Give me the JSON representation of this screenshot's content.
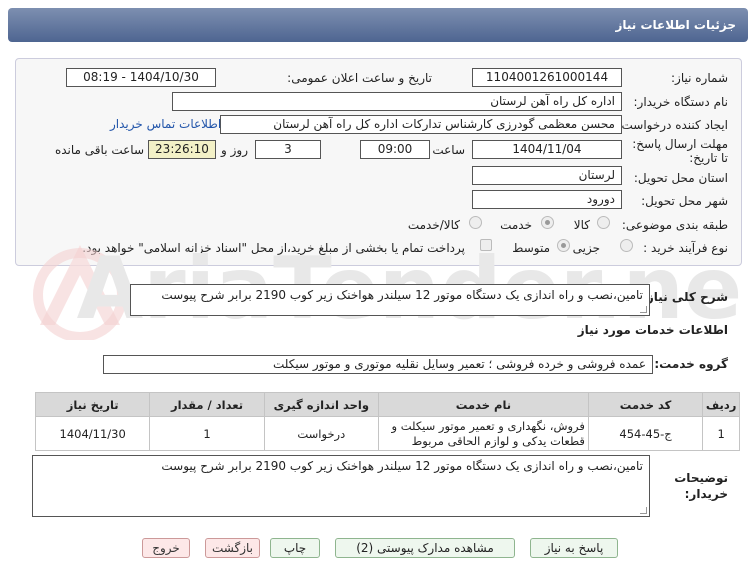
{
  "header": {
    "title": "جزئیات اطلاعات نیاز"
  },
  "form": {
    "need_number_label": "شماره نیاز:",
    "need_number": "1104001261000144",
    "announce_label": "تاریخ و ساعت اعلان عمومی:",
    "announce_value": "1404/10/30 - 08:19",
    "buyer_org_label": "نام دستگاه خریدار:",
    "buyer_org": "اداره کل راه آهن لرستان",
    "creator_label": "ایجاد کننده درخواست:",
    "creator": "محسن معظمی گودرزی کارشناس تدارکات اداره کل راه آهن لرستان",
    "contact_link": "اطلاعات تماس خریدار",
    "deadline_label": "مهلت ارسال پاسخ: تا تاریخ:",
    "deadline_date": "1404/11/04",
    "time_label": "ساعت",
    "deadline_time": "09:00",
    "days_value": "3",
    "days_label": "روز و",
    "remaining_time": "23:26:10",
    "remaining_label": "ساعت باقی مانده",
    "province_label": "استان محل تحویل:",
    "province": "لرستان",
    "city_label": "شهر محل تحویل:",
    "city": "دورود",
    "category_label": "طبقه بندی موضوعی:",
    "category_options": [
      "کالا",
      "خدمت",
      "کالا/خدمت"
    ],
    "category_selected": "خدمت",
    "process_label": "نوع فرآیند خرید :",
    "process_options": [
      "جزیی",
      "متوسط"
    ],
    "process_selected": "متوسط",
    "payment_note": "پرداخت تمام یا بخشی از مبلغ خرید،از محل \"اسناد خزانه اسلامی\" خواهد بود."
  },
  "summary": {
    "label": "شرح کلی نیاز:",
    "text": "تامین،نصب و راه اندازی یک دستگاه موتور 12 سیلندر هواخنک زیر کوب 2190 برابر شرح پیوست"
  },
  "services": {
    "section_title": "اطلاعات خدمات مورد نیاز",
    "group_label": "گروه خدمت:",
    "group_value": "عمده فروشی و خرده فروشی ؛ تعمیر وسایل نقلیه موتوری و موتور سیکلت",
    "columns": [
      "ردیف",
      "کد خدمت",
      "نام خدمت",
      "واحد اندازه گیری",
      "تعداد / مقدار",
      "تاریخ نیاز"
    ],
    "rows": [
      {
        "row": "1",
        "code": "ج-45-454",
        "name": "فروش، نگهداری و تعمیر موتور سیکلت و قطعات یدکی و لوازم الحاقی مربوط",
        "unit": "درخواست",
        "qty": "1",
        "date": "1404/11/30"
      }
    ]
  },
  "buyer_notes": {
    "label": "توضیحات خریدار:",
    "text": "تامین،نصب و راه اندازی یک دستگاه موتور 12 سیلندر هواخنک زیر کوب 2190 برابر شرح پیوست"
  },
  "buttons": {
    "reply": "پاسخ به نیاز",
    "view_attachments": "مشاهده مدارک پیوستی (2)",
    "print": "چاپ",
    "back": "بازگشت",
    "exit": "خروج"
  },
  "watermark": {
    "text": "AriaTender.net"
  },
  "colors": {
    "header": "#5a6f98",
    "link": "#2255aa",
    "highlight": "#f3f1c7",
    "watermark": "#e3e3e3"
  }
}
